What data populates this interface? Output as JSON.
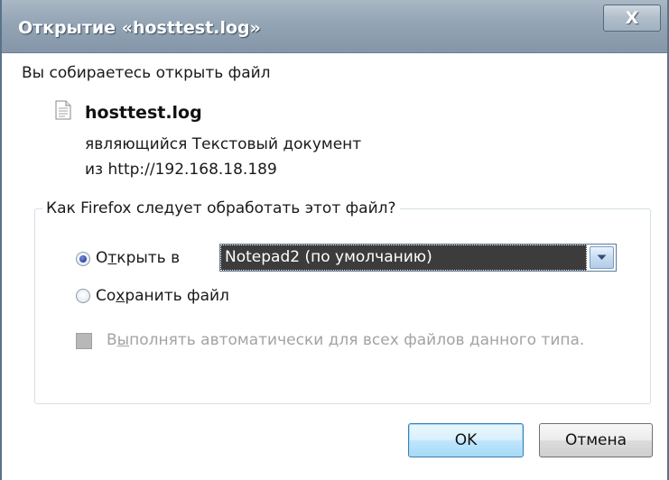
{
  "window": {
    "title": "Открытие «hosttest.log»",
    "close_label": "X"
  },
  "prompt": "Вы собираетесь открыть файл",
  "file": {
    "name": "hosttest.log",
    "icon": "text-file-icon",
    "type_prefix": "являющийся",
    "type_value": "Текстовый документ",
    "from_prefix": "из",
    "from_value": "http://192.168.18.189"
  },
  "action_group": {
    "legend": "Как Firefox следует обработать этот файл?",
    "open_with": {
      "label_before": "О",
      "label_mnemonic": "т",
      "label_after": "крыть в",
      "selected": true,
      "app": "Notepad2 (по умолчанию)"
    },
    "save_file": {
      "label_before": "Со",
      "label_mnemonic": "х",
      "label_after": "ранить файл",
      "selected": false
    },
    "auto_checkbox": {
      "label_before": "В",
      "label_mnemonic": "ы",
      "label_after": "полнять автоматически для всех файлов данного типа.",
      "checked": false,
      "disabled": true
    }
  },
  "buttons": {
    "ok": "OK",
    "cancel": "Отмена"
  },
  "colors": {
    "titlebar": "#93a4b5",
    "select_highlight": "#3c3c3c",
    "disabled_text": "#a3a3a3",
    "ok_button": "#bee6fd"
  }
}
